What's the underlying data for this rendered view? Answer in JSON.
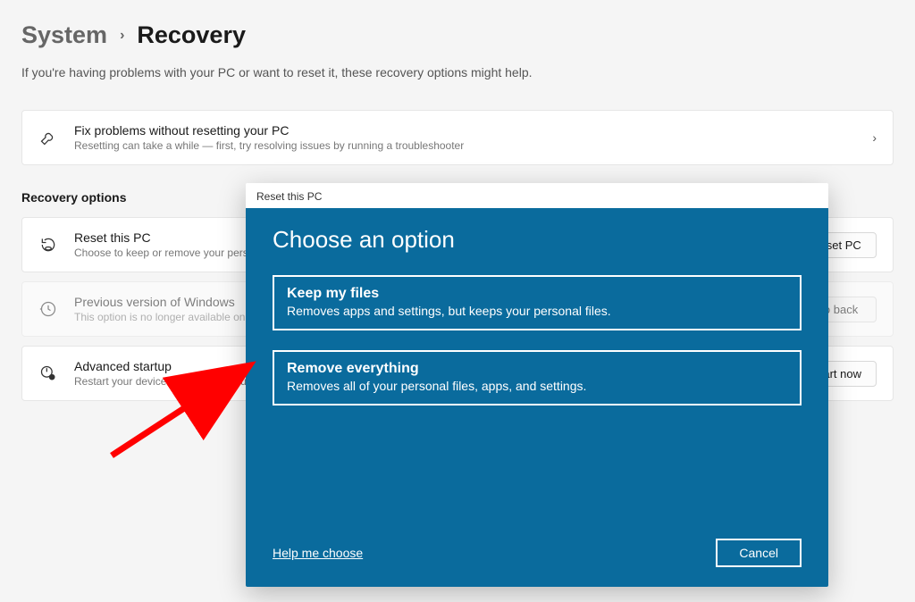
{
  "breadcrumb": {
    "parent": "System",
    "current": "Recovery"
  },
  "subtitle": "If you're having problems with your PC or want to reset it, these recovery options might help.",
  "cards": {
    "fix": {
      "title": "Fix problems without resetting your PC",
      "desc": "Resetting can take a while — first, try resolving issues by running a troubleshooter"
    },
    "reset": {
      "title": "Reset this PC",
      "desc": "Choose to keep or remove your personal files, then reinstall Windows",
      "button": "Reset PC"
    },
    "previous": {
      "title": "Previous version of Windows",
      "desc": "This option is no longer available on this PC",
      "button": "Go back"
    },
    "advanced": {
      "title": "Advanced startup",
      "desc": "Restart your device to change startup settings, including starting from a disc or USB drive",
      "button": "Restart now"
    }
  },
  "section_heading": "Recovery options",
  "modal": {
    "titlebar": "Reset this PC",
    "heading": "Choose an option",
    "options": [
      {
        "title": "Keep my files",
        "desc": "Removes apps and settings, but keeps your personal files."
      },
      {
        "title": "Remove everything",
        "desc": "Removes all of your personal files, apps, and settings."
      }
    ],
    "help_link": "Help me choose",
    "cancel": "Cancel"
  }
}
